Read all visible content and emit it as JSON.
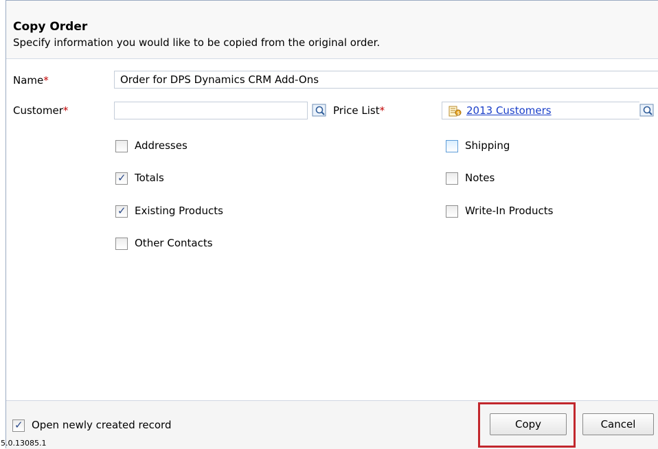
{
  "header": {
    "title": "Copy Order",
    "description": "Specify information you would like to be copied from the original order."
  },
  "form": {
    "name_label": "Name",
    "name_value": "Order for DPS Dynamics CRM Add-Ons",
    "customer_label": "Customer",
    "customer_value": "",
    "price_list_label": "Price List",
    "price_list_value": "2013 Customers",
    "required_marker": "*"
  },
  "options": {
    "addresses": {
      "label": "Addresses",
      "checked": false
    },
    "totals": {
      "label": "Totals",
      "checked": true
    },
    "existing_products": {
      "label": "Existing Products",
      "checked": true
    },
    "other_contacts": {
      "label": "Other Contacts",
      "checked": false
    },
    "shipping": {
      "label": "Shipping",
      "checked": false
    },
    "notes": {
      "label": "Notes",
      "checked": false
    },
    "write_in_products": {
      "label": "Write-In Products",
      "checked": false
    }
  },
  "footer": {
    "open_record_label": "Open newly created record",
    "open_record_checked": true,
    "copy_label": "Copy",
    "cancel_label": "Cancel",
    "version": "5.0.13085.1"
  },
  "colors": {
    "required": "#c00000",
    "link": "#1a3fc9",
    "highlight": "#c2272d"
  }
}
